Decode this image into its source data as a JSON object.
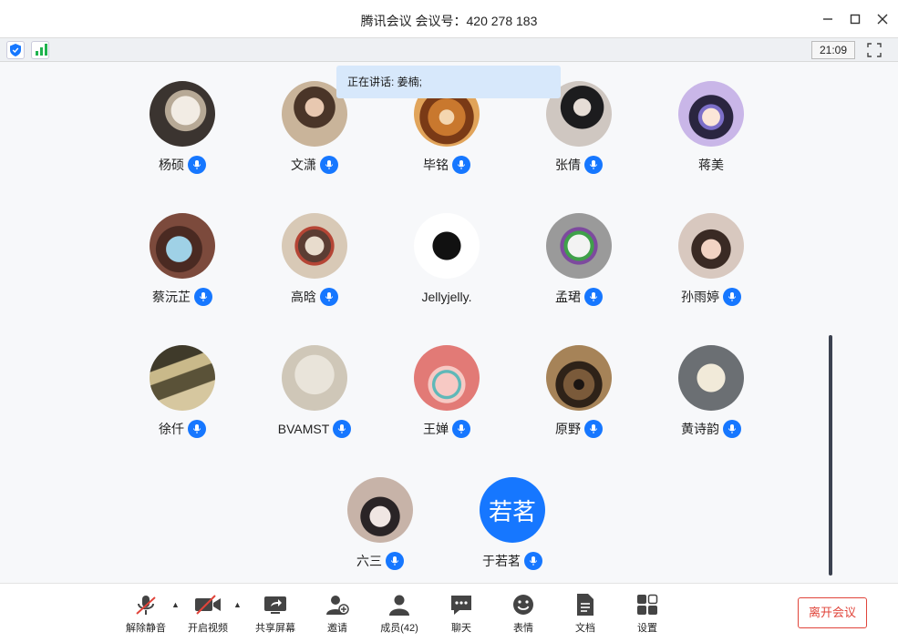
{
  "window": {
    "title": "腾讯会议 会议号：420 278 183",
    "minimize_icon": "minimize-icon",
    "maximize_icon": "maximize-icon",
    "close_icon": "close-icon"
  },
  "status": {
    "time": "21:09",
    "signal_bars": 3
  },
  "speaking": {
    "text": "正在讲话: 姜楠;"
  },
  "participants": [
    {
      "name": "杨硕",
      "mic": true,
      "avatar": "photo-lamb"
    },
    {
      "name": "文潇",
      "mic": true,
      "avatar": "photo-girl"
    },
    {
      "name": "毕铭",
      "mic": true,
      "avatar": "photo-dog"
    },
    {
      "name": "张倩",
      "mic": true,
      "avatar": "photo-girl-cap"
    },
    {
      "name": "蒋美",
      "mic": false,
      "avatar": "anime-girl"
    },
    {
      "name": "蔡沅芷",
      "mic": true,
      "avatar": "painting"
    },
    {
      "name": "高晗",
      "mic": true,
      "avatar": "sketch-art"
    },
    {
      "name": "Jellyjelly.",
      "mic": false,
      "avatar": "teddy-bear"
    },
    {
      "name": "孟珺",
      "mic": true,
      "avatar": "joker-cartoon"
    },
    {
      "name": "孙雨婷",
      "mic": true,
      "avatar": "girl-red-bow"
    },
    {
      "name": "徐仟",
      "mic": true,
      "avatar": "stairs-photo"
    },
    {
      "name": "BVAMST",
      "mic": true,
      "avatar": "line-drawing"
    },
    {
      "name": "王婵",
      "mic": true,
      "avatar": "pink-anime"
    },
    {
      "name": "原野",
      "mic": true,
      "avatar": "night-street"
    },
    {
      "name": "黄诗韵",
      "mic": true,
      "avatar": "plush-bunny"
    },
    {
      "name": "六三",
      "mic": true,
      "avatar": "cat-photo"
    },
    {
      "name": "于若茗",
      "mic": true,
      "avatar_text": "若茗",
      "avatar_color": "#1677ff"
    }
  ],
  "toolbar": {
    "unmute": "解除静音",
    "video": "开启视频",
    "share": "共享屏幕",
    "invite": "邀请",
    "members": "成员(42)",
    "chat": "聊天",
    "reactions": "表情",
    "docs": "文档",
    "settings": "设置",
    "leave": "离开会议"
  },
  "colors": {
    "accent": "#1677ff",
    "leave": "#e0443a",
    "mute_slash": "#e0443a",
    "speaking_bg": "#d7e8fb"
  }
}
